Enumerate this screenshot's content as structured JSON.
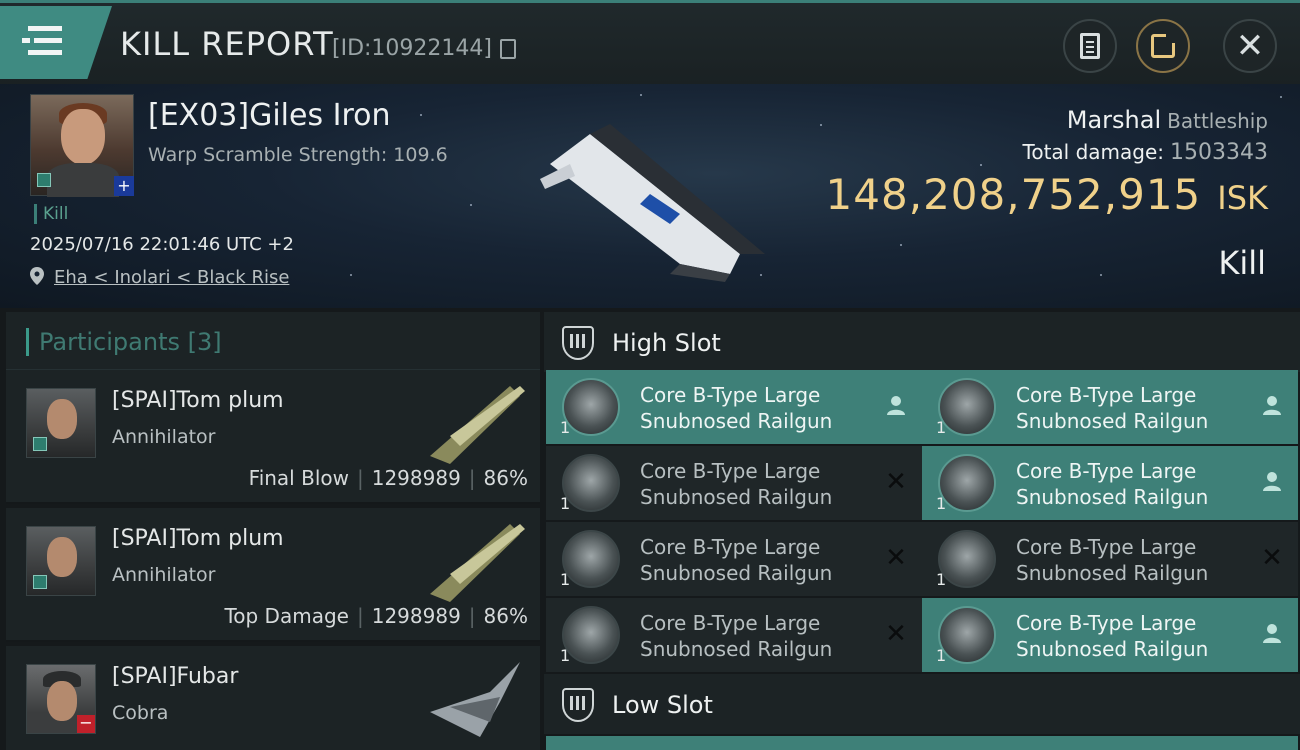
{
  "header": {
    "title": "KILL REPORT",
    "kill_id": "[ID:10922144]"
  },
  "victim": {
    "name": "[EX03]Giles Iron",
    "warp_scramble": "Warp Scramble Strength: 109.6",
    "kill_tag": "Kill",
    "timestamp": "2025/07/16 22:01:46 UTC +2",
    "location": "Eha < Inolari < Black Rise",
    "ship_name": "Marshal",
    "ship_class": "Battleship",
    "total_damage_label": "Total damage:",
    "total_damage": "1503343",
    "isk_value": "148,208,752,915",
    "isk_unit": "ISK",
    "result": "Kill"
  },
  "participants": {
    "header": "Participants [3]",
    "rows": [
      {
        "name": "[SPAI]Tom plum",
        "ship": "Annihilator",
        "role": "Final Blow",
        "damage": "1298989",
        "percent": "86%"
      },
      {
        "name": "[SPAI]Tom plum",
        "ship": "Annihilator",
        "role": "Top Damage",
        "damage": "1298989",
        "percent": "86%"
      },
      {
        "name": "[SPAI]Fubar",
        "ship": "Cobra"
      }
    ]
  },
  "slots": {
    "high_title": "High Slot",
    "low_title": "Low Slot",
    "high_modules": [
      {
        "name1": "Core B-Type Large",
        "name2": "Snubnosed Railgun",
        "qty": "1",
        "state": "fitted"
      },
      {
        "name1": "Core B-Type Large",
        "name2": "Snubnosed Railgun",
        "qty": "1",
        "state": "fitted"
      },
      {
        "name1": "Core B-Type Large",
        "name2": "Snubnosed Railgun",
        "qty": "1",
        "state": "destroyed"
      },
      {
        "name1": "Core B-Type Large",
        "name2": "Snubnosed Railgun",
        "qty": "1",
        "state": "fitted"
      },
      {
        "name1": "Core B-Type Large",
        "name2": "Snubnosed Railgun",
        "qty": "1",
        "state": "destroyed"
      },
      {
        "name1": "Core B-Type Large",
        "name2": "Snubnosed Railgun",
        "qty": "1",
        "state": "destroyed"
      },
      {
        "name1": "Core B-Type Large",
        "name2": "Snubnosed Railgun",
        "qty": "1",
        "state": "destroyed"
      },
      {
        "name1": "Core B-Type Large",
        "name2": "Snubnosed Railgun",
        "qty": "1",
        "state": "fitted"
      }
    ]
  },
  "colors": {
    "accent": "#3e8078",
    "isk": "#f0d18a",
    "background": "#15191b"
  },
  "icons": {
    "menu": "menu-icon",
    "copy": "copy-icon",
    "report": "document-icon",
    "share": "share-icon",
    "close": "close-icon",
    "location": "pin-icon",
    "fitted": "person-icon",
    "destroyed": "x-icon",
    "slot": "shield-icon"
  }
}
